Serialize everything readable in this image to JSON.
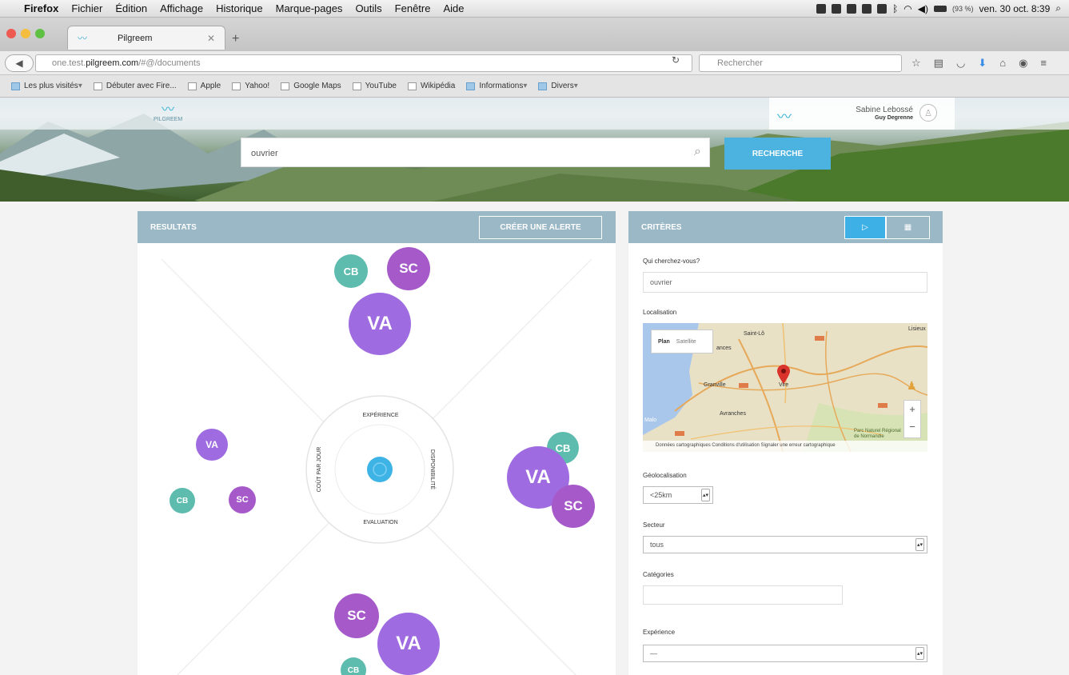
{
  "menubar": {
    "apple": "",
    "items": [
      "Firefox",
      "Fichier",
      "Édition",
      "Affichage",
      "Historique",
      "Marque-pages",
      "Outils",
      "Fenêtre",
      "Aide"
    ],
    "battery": "(93 %)",
    "clock": "ven. 30 oct. 8:39"
  },
  "browser": {
    "tab_title": "Pilgreem",
    "url_host": "one.test.",
    "url_domain": "pilgreem.com",
    "url_path": "/#@/documents",
    "search_placeholder": "Rechercher"
  },
  "bookmarks": [
    {
      "label": "Les plus visités",
      "folder": true,
      "dropdown": true
    },
    {
      "label": "Débuter avec Fire...",
      "folder": false
    },
    {
      "label": "Apple",
      "folder": false
    },
    {
      "label": "Yahoo!",
      "folder": false
    },
    {
      "label": "Google Maps",
      "folder": false
    },
    {
      "label": "YouTube",
      "folder": false
    },
    {
      "label": "Wikipédia",
      "folder": false
    },
    {
      "label": "Informations",
      "folder": true,
      "dropdown": true
    },
    {
      "label": "Divers",
      "folder": true,
      "dropdown": true
    }
  ],
  "app": {
    "logo_text": "PILGREEM",
    "user_name": "Sabine Lebossé",
    "user_sub": "Guy Degrenne",
    "search_value": "ouvrier",
    "search_button": "RECHERCHE"
  },
  "results": {
    "title": "RESULTATS",
    "alert_button": "CRÉER UNE ALERTE",
    "axes": {
      "top": "EXPÉRIENCE",
      "bottom": "EVALUATION",
      "left": "COÛT PAR JOUR",
      "right": "DISPONIBILITÉ"
    },
    "bubble_labels": {
      "cb": "CB",
      "sc": "SC",
      "va": "VA"
    },
    "colors": {
      "teal": "#5dbcae",
      "purple": "#a659c9",
      "violet": "#9e6be0",
      "center": "#3db3e6"
    }
  },
  "criteria": {
    "title": "CRITÈRES",
    "toggle_left": "▷",
    "toggle_right": "▦",
    "who_label": "Qui cherchez-vous?",
    "who_value": "ouvrier",
    "location_label": "Localisation",
    "map": {
      "plan": "Plan",
      "satellite": "Satellite",
      "places": [
        "Saint-Lô",
        "Granville",
        "Vire",
        "Avranches",
        "Lisieux",
        "Malo",
        "Parc Naturel Régional de Normandie",
        "ances"
      ],
      "footer": "Données cartographiques   Conditions d'utilisation   Signaler une erreur cartographique"
    },
    "geoloc_label": "Géolocalisation",
    "geoloc_value": "<25km",
    "sector_label": "Secteur",
    "sector_value": "tous",
    "categories_label": "Catégories",
    "experience_label": "Expérience",
    "experience_value": "—"
  }
}
